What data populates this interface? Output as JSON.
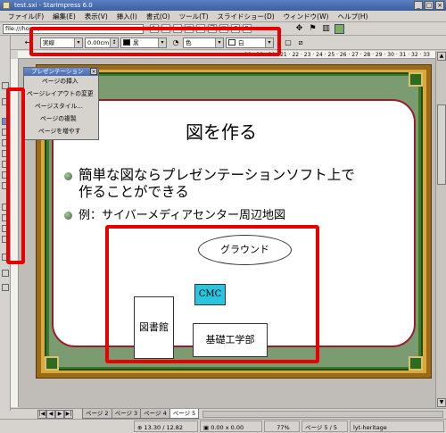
{
  "window": {
    "title": "test.sxi - StarImpress 6.0",
    "controls": [
      "_",
      "□",
      "×"
    ]
  },
  "menu": [
    "ファイル(F)",
    "編集(E)",
    "表示(V)",
    "挿入(I)",
    "書式(O)",
    "ツール(T)",
    "スライドショー(D)",
    "ウィンドウ(W)",
    "ヘルプ(H)"
  ],
  "address": {
    "value": "file:///home/..."
  },
  "format_toolbar": {
    "line_style": "実線",
    "line_width": "0.00cm",
    "line_color": "黒",
    "line_color_hex": "#000000",
    "area_style": "色",
    "area_color": "白",
    "area_color_hex": "#ffffff"
  },
  "ruler": {
    "top_scale": "18 · 19 · 20 · 21 · 22 · 23 · 24 · 25 · 26 · 27 · 28 · 29 · 30 · 31 · 32 · 33"
  },
  "navigator": {
    "title": "プレゼンテーション",
    "buttons": [
      "ページの挿入",
      "ページレイアウトの変更",
      "ページスタイル...",
      "ページの複製",
      "ページを増やす"
    ]
  },
  "slide": {
    "title": "図を作る",
    "bullets": [
      "簡単な図ならプレゼンテーションソフト上で作ることができる",
      "例：サイバーメディアセンター周辺地図"
    ],
    "bullet1_line1": "簡単な図ならプレゼンテーションソフト上で",
    "bullet1_line2": "作ることができる",
    "map": {
      "ground": "グラウンド",
      "cmc": "CMC",
      "cmc_color": "#29c4e0",
      "library": "図書館",
      "engineering": "基礎工学部"
    }
  },
  "tabs": [
    "ページ 2",
    "ページ 3",
    "ページ 4",
    "ページ 5"
  ],
  "active_tab": "ページ 5",
  "status": {
    "position": "13.30 / 12.82",
    "size": "0.00 x 0.00",
    "zoom": "77%",
    "page": "ページ 5 / 5",
    "style": "lyt-heritage"
  },
  "highlight_color": "#e80000"
}
